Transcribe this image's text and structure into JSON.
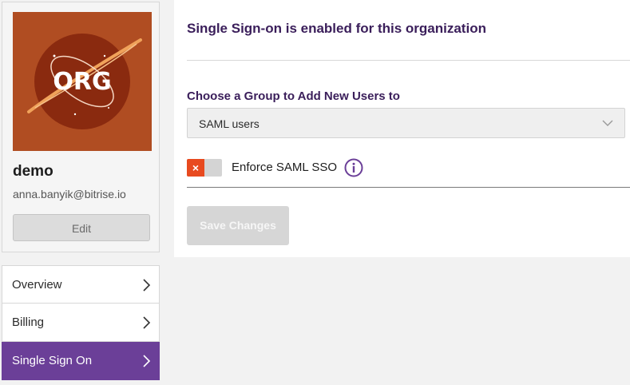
{
  "profile": {
    "avatar_text": "ORG",
    "name": "demo",
    "email": "anna.banyik@bitrise.io",
    "edit_label": "Edit"
  },
  "nav": {
    "items": [
      {
        "label": "Overview",
        "active": false
      },
      {
        "label": "Billing",
        "active": false
      },
      {
        "label": "Single Sign On",
        "active": true
      }
    ]
  },
  "main": {
    "title": "Single Sign-on is enabled for this organization",
    "group_label": "Choose a Group to Add New Users to",
    "group_selected": "SAML users",
    "enforce_label": "Enforce SAML SSO",
    "enforce_enabled": false,
    "save_label": "Save Changes"
  },
  "colors": {
    "accent": "#6b3f98",
    "title": "#3a1e5a",
    "toggle_off": "#e84a1f",
    "avatar_bg": "#b04d22"
  },
  "icons": {
    "avatar": "org-logo",
    "nav_chevron": "chevron-right-icon",
    "select_chevron": "chevron-down-icon",
    "info": "info-icon",
    "toggle_off": "x-icon"
  }
}
